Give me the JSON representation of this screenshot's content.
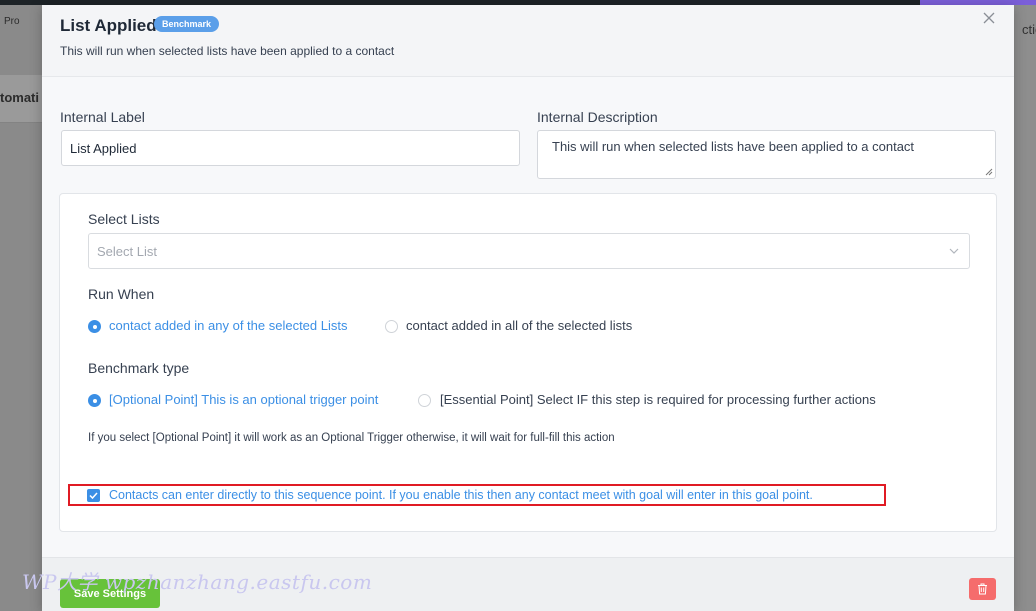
{
  "background": {
    "pro_label": "Pro",
    "automation_label": "tomati",
    "actions_label": "ctions"
  },
  "modal": {
    "title": "List Applied",
    "badge": "Benchmark",
    "subtitle": "This will run when selected lists have been applied to a contact",
    "close_icon": "close-icon"
  },
  "internal_label": {
    "label": "Internal Label",
    "value": "List Applied"
  },
  "internal_description": {
    "label": "Internal Description",
    "value": "This will run when selected lists have been applied to a contact"
  },
  "select_lists": {
    "label": "Select Lists",
    "placeholder": "Select List"
  },
  "run_when": {
    "label": "Run When",
    "options": [
      {
        "label": "contact added in any of the selected Lists",
        "selected": true
      },
      {
        "label": "contact added in all of the selected lists",
        "selected": false
      }
    ]
  },
  "benchmark_type": {
    "label": "Benchmark type",
    "options": [
      {
        "label": "[Optional Point] This is an optional trigger point",
        "selected": true
      },
      {
        "label": "[Essential Point] Select IF this step is required for processing further actions",
        "selected": false
      }
    ],
    "help": "If you select [Optional Point] it will work as an Optional Trigger otherwise, it will wait for full-fill this action"
  },
  "direct_entry": {
    "label": "Contacts can enter directly to this sequence point. If you enable this then any contact meet with goal will enter in this goal point.",
    "checked": true
  },
  "footer": {
    "save_label": "Save Settings",
    "delete_icon": "trash-icon"
  },
  "watermark": "WP大学 wpzhanzhang.eastfu.com",
  "colors": {
    "accent": "#3b8fe5",
    "badge": "#5b9fe9",
    "save": "#67c23a",
    "delete": "#f56c6c",
    "highlight": "#e01b24"
  }
}
